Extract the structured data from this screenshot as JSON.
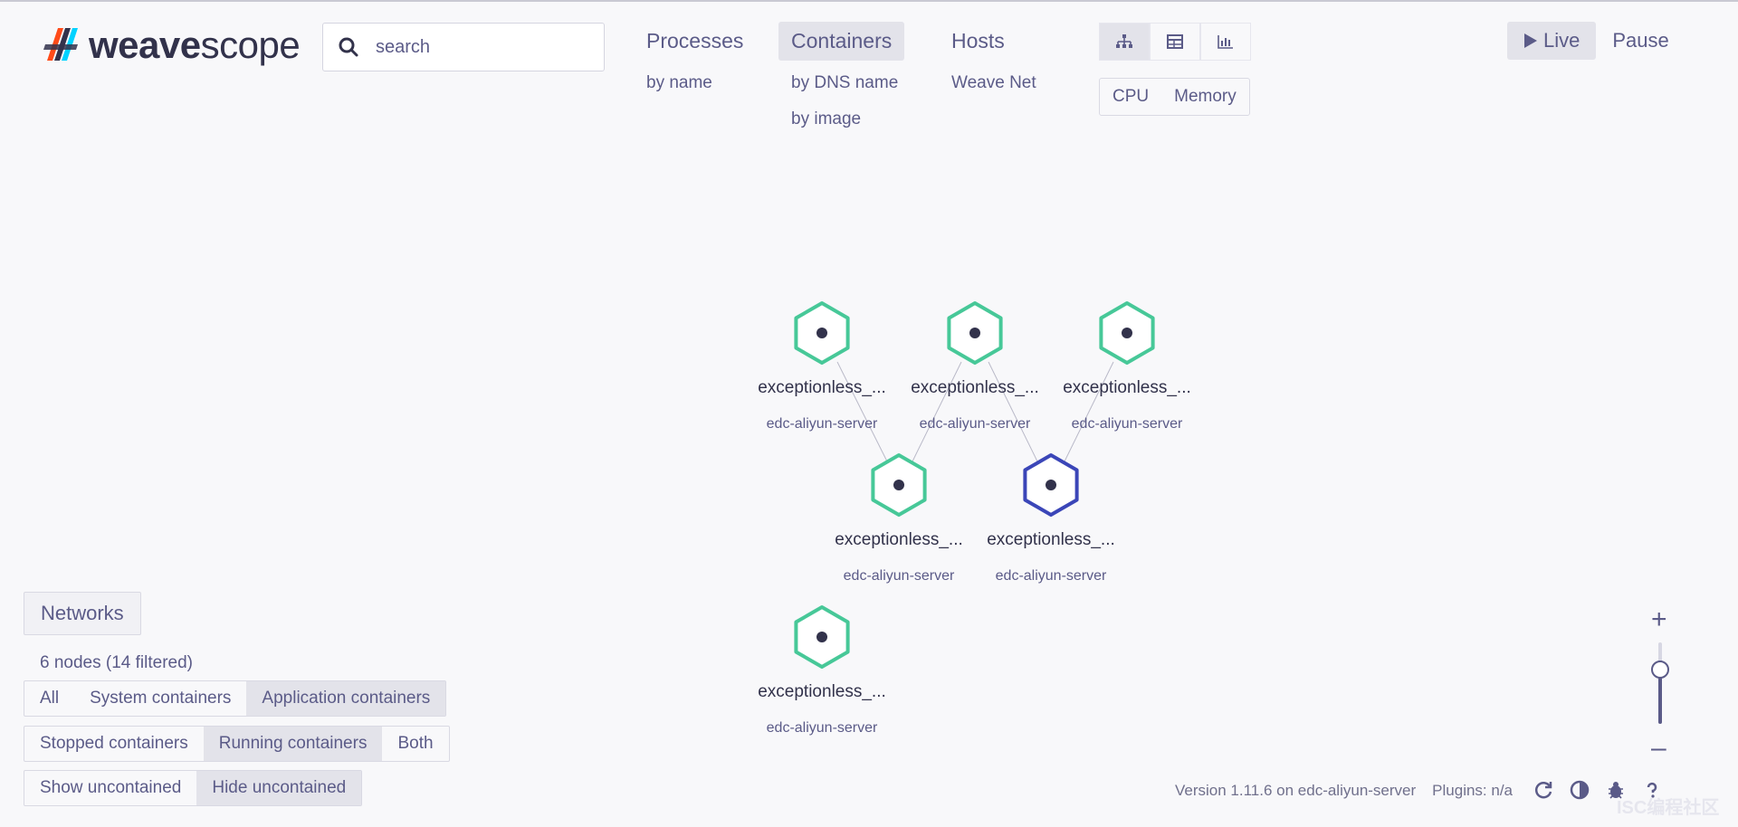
{
  "logo": {
    "text_bold": "weave",
    "text_thin": "scope"
  },
  "search": {
    "placeholder": "search"
  },
  "topologies": [
    {
      "label": "Processes",
      "subs": [
        "by name"
      ]
    },
    {
      "label": "Containers",
      "subs": [
        "by DNS name",
        "by image"
      ],
      "active": true
    },
    {
      "label": "Hosts",
      "subs": [
        "Weave Net"
      ]
    }
  ],
  "view_modes": [
    "graph-icon",
    "table-icon",
    "resources-icon"
  ],
  "metrics": [
    "CPU",
    "Memory"
  ],
  "time_control": {
    "live": "Live",
    "pause": "Pause"
  },
  "nodes": [
    {
      "label": "exceptionless_...",
      "sub": "edc-aliyun-server",
      "color": "#47c898"
    },
    {
      "label": "exceptionless_...",
      "sub": "edc-aliyun-server",
      "color": "#47c898"
    },
    {
      "label": "exceptionless_...",
      "sub": "edc-aliyun-server",
      "color": "#47c898"
    },
    {
      "label": "exceptionless_...",
      "sub": "edc-aliyun-server",
      "color": "#47c898"
    },
    {
      "label": "exceptionless_...",
      "sub": "edc-aliyun-server",
      "color": "#3b46b8"
    },
    {
      "label": "exceptionless_...",
      "sub": "edc-aliyun-server",
      "color": "#47c898"
    }
  ],
  "networks_label": "Networks",
  "node_count": "6 nodes (14 filtered)",
  "filters": {
    "containers": [
      "All",
      "System containers",
      "Application containers"
    ],
    "state": [
      "Stopped containers",
      "Running containers",
      "Both"
    ],
    "uncontained": [
      "Show uncontained",
      "Hide uncontained"
    ]
  },
  "zoom": {
    "plus": "+",
    "minus": "–"
  },
  "footer": {
    "version": "Version 1.11.6 on edc-aliyun-server",
    "plugins": "Plugins: n/a"
  },
  "watermark": "ISC编程社区"
}
